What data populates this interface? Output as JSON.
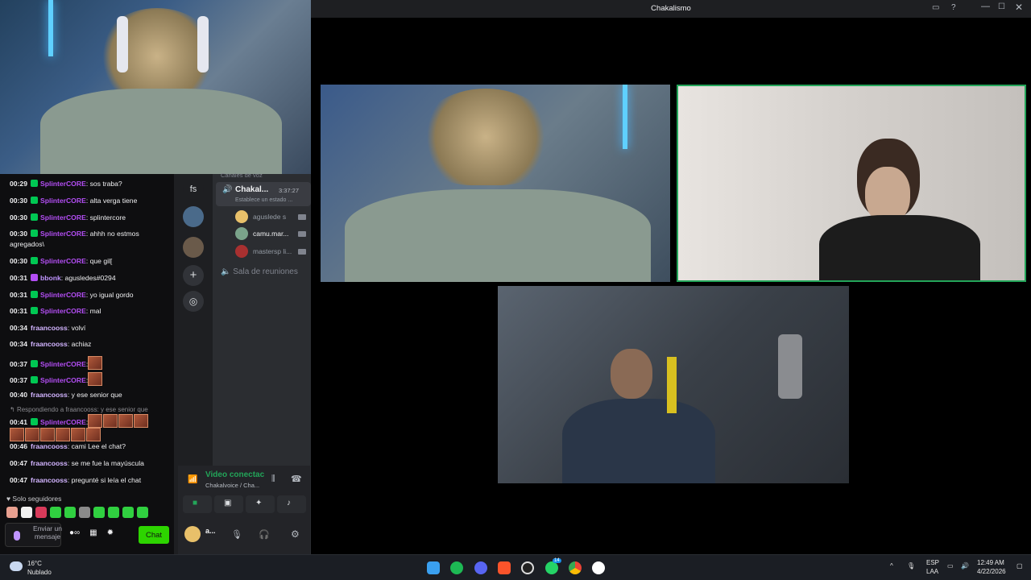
{
  "window": {
    "title": "Chakalismo"
  },
  "chat": {
    "messages": [
      {
        "time": "00:29",
        "user": "SplinterCORE",
        "text": ": sos traba?",
        "color": "#b44ef5"
      },
      {
        "time": "00:30",
        "user": "SplinterCORE",
        "text": ": alta verga tiene",
        "color": "#b44ef5"
      },
      {
        "time": "00:30",
        "user": "SplinterCORE",
        "text": ": splintercore",
        "color": "#b44ef5"
      },
      {
        "time": "00:30",
        "user": "SplinterCORE",
        "text": ": ahhh no estmos agregados\\",
        "color": "#b44ef5"
      },
      {
        "time": "00:30",
        "user": "SplinterCORE",
        "text": ": que gil[",
        "color": "#b44ef5"
      },
      {
        "time": "00:31",
        "user": "bbonk",
        "text": ": agusledes#0294",
        "color": "#bf94ff"
      },
      {
        "time": "00:31",
        "user": "SplinterCORE",
        "text": ": yo igual gordo",
        "color": "#b44ef5"
      },
      {
        "time": "00:31",
        "user": "SplinterCORE",
        "text": ": mal",
        "color": "#b44ef5"
      },
      {
        "time": "00:34",
        "user": "fraancooss",
        "text": ": volví",
        "color": "#d2b4ff"
      },
      {
        "time": "00:34",
        "user": "fraancooss",
        "text": ": achiaz",
        "color": "#d2b4ff"
      },
      {
        "time": "00:37",
        "user": "SplinterCORE",
        "text": ":",
        "color": "#b44ef5"
      },
      {
        "time": "00:37",
        "user": "SplinterCORE",
        "text": ":",
        "color": "#b44ef5"
      },
      {
        "time": "00:40",
        "user": "fraancooss",
        "text": ": y ese senior que",
        "color": "#d2b4ff"
      },
      {
        "time": "00:41",
        "user": "SplinterCORE",
        "text": ":",
        "color": "#b44ef5"
      },
      {
        "time": "00:46",
        "user": "fraancooss",
        "text": ": cami Lee el chat?",
        "color": "#d2b4ff"
      },
      {
        "time": "00:47",
        "user": "fraancooss",
        "text": ": se me fue la mayúscula",
        "color": "#d2b4ff"
      },
      {
        "time": "00:47",
        "user": "fraancooss",
        "text": ": pregunté si leía el chat",
        "color": "#d2b4ff"
      }
    ],
    "reply_ref": "Respondiendo a fraancooss: y ese senior que",
    "followers_only": "Solo seguidores",
    "input_placeholder": "Enviar un mensaje",
    "chat_button": "Chat"
  },
  "discord": {
    "server_label": "fs",
    "voice_section": "Canales de voz",
    "active_channel": {
      "name": "Chakal...",
      "timer": "3:37:27",
      "status": "Establece un estado ..."
    },
    "voice_users": [
      "aguslede s",
      "camu.mar...",
      "mastersp li..."
    ],
    "meeting_room": "Sala de reuniones",
    "video_status": "Video conectac",
    "voice_path": "Chakalvoice / Cha...",
    "user_initial": "a..."
  },
  "taskbar": {
    "weather_temp": "16°C",
    "weather_desc": "Nublado",
    "lang1": "ESP",
    "lang2": "LAA",
    "time": "12:49 AM",
    "date": "4/22/2026",
    "whatsapp_badge": "14"
  }
}
